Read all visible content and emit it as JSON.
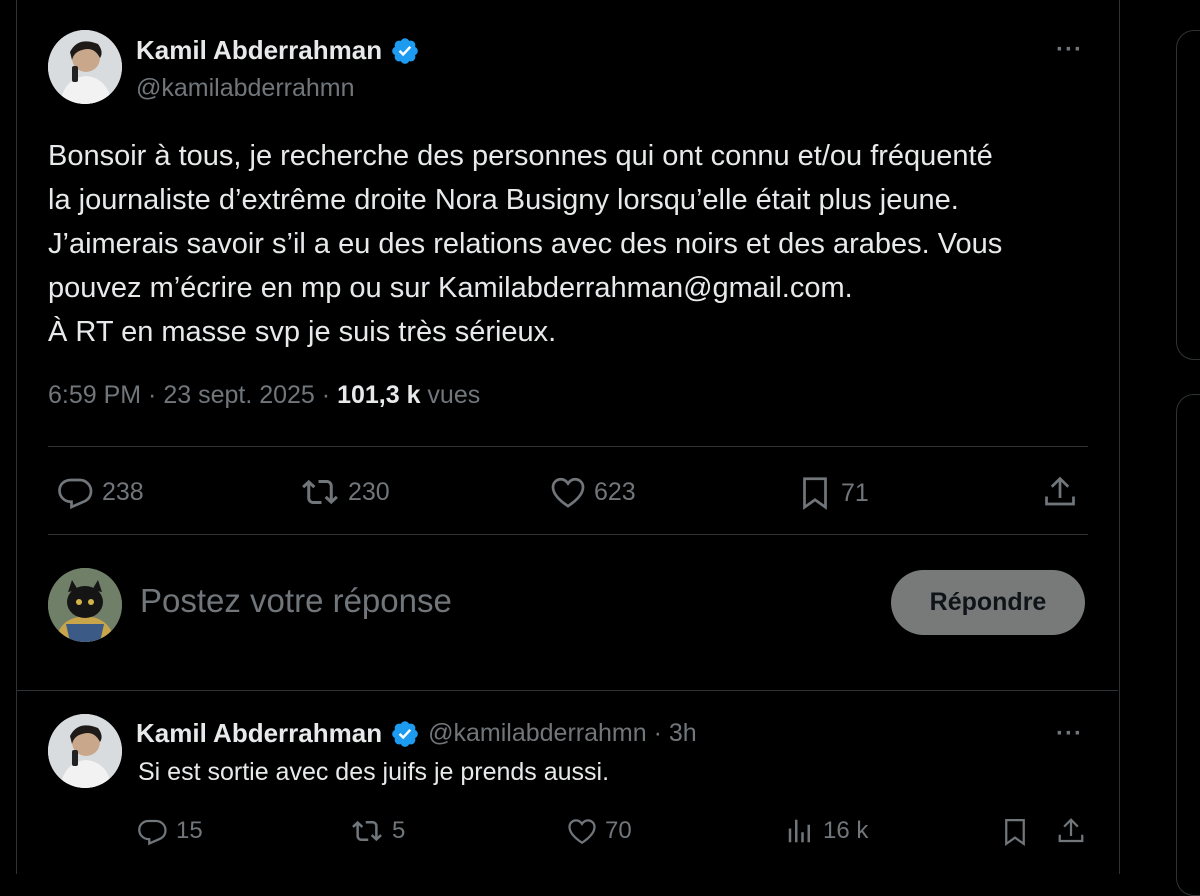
{
  "tweet": {
    "author_name": "Kamil Abderrahman",
    "handle": "@kamilabderrahmn",
    "lines": [
      "Bonsoir à tous, je recherche des personnes qui ont connu et/ou fréquenté",
      "la journaliste d’extrême droite Nora Busigny lorsqu’elle était plus jeune.",
      "J’aimerais savoir s’il a eu des relations avec des noirs et des arabes. Vous",
      "pouvez m’écrire en mp ou sur Kamilabderrahman@gmail.com.",
      "À RT en masse svp je suis très sérieux."
    ],
    "time": "6:59 PM · 23 sept. 2025 · ",
    "views_count": "101,3 k",
    "views_label": " vues",
    "more_label": "···",
    "stats": {
      "replies": "238",
      "reposts": "230",
      "likes": "623",
      "bookmarks": "71"
    }
  },
  "composer": {
    "placeholder": "Postez votre réponse",
    "button_label": "Répondre"
  },
  "reply": {
    "author_name": "Kamil Abderrahman",
    "handle_time": "@kamilabderrahmn · 3h",
    "text": "Si est sortie avec des juifs je prends aussi.",
    "more_label": "···",
    "stats": {
      "replies": "15",
      "reposts": "5",
      "likes": "70",
      "views": "16 k"
    }
  },
  "colors": {
    "background": "#000000",
    "text": "#e7e9ea",
    "muted": "#71767b",
    "verified": "#1d9bf0",
    "divider": "#2f3336"
  }
}
